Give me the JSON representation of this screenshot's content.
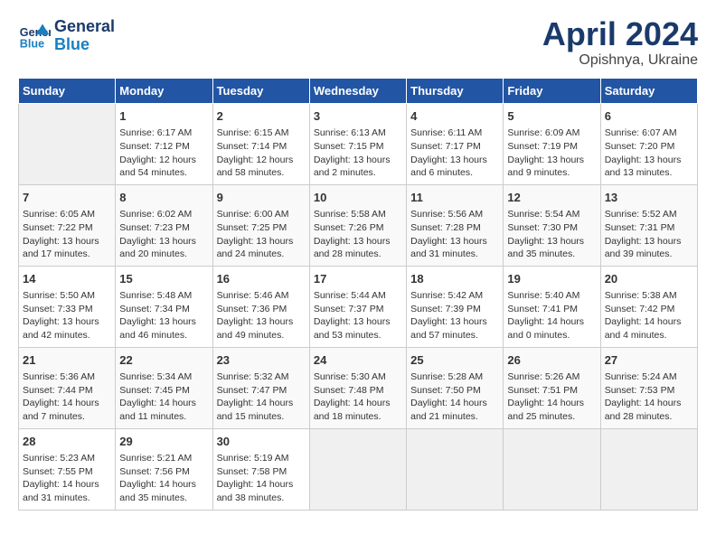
{
  "header": {
    "logo_line1": "General",
    "logo_line2": "Blue",
    "month": "April 2024",
    "location": "Opishnya, Ukraine"
  },
  "days_of_week": [
    "Sunday",
    "Monday",
    "Tuesday",
    "Wednesday",
    "Thursday",
    "Friday",
    "Saturday"
  ],
  "weeks": [
    [
      {
        "day": "",
        "content": ""
      },
      {
        "day": "1",
        "content": "Sunrise: 6:17 AM\nSunset: 7:12 PM\nDaylight: 12 hours\nand 54 minutes."
      },
      {
        "day": "2",
        "content": "Sunrise: 6:15 AM\nSunset: 7:14 PM\nDaylight: 12 hours\nand 58 minutes."
      },
      {
        "day": "3",
        "content": "Sunrise: 6:13 AM\nSunset: 7:15 PM\nDaylight: 13 hours\nand 2 minutes."
      },
      {
        "day": "4",
        "content": "Sunrise: 6:11 AM\nSunset: 7:17 PM\nDaylight: 13 hours\nand 6 minutes."
      },
      {
        "day": "5",
        "content": "Sunrise: 6:09 AM\nSunset: 7:19 PM\nDaylight: 13 hours\nand 9 minutes."
      },
      {
        "day": "6",
        "content": "Sunrise: 6:07 AM\nSunset: 7:20 PM\nDaylight: 13 hours\nand 13 minutes."
      }
    ],
    [
      {
        "day": "7",
        "content": "Sunrise: 6:05 AM\nSunset: 7:22 PM\nDaylight: 13 hours\nand 17 minutes."
      },
      {
        "day": "8",
        "content": "Sunrise: 6:02 AM\nSunset: 7:23 PM\nDaylight: 13 hours\nand 20 minutes."
      },
      {
        "day": "9",
        "content": "Sunrise: 6:00 AM\nSunset: 7:25 PM\nDaylight: 13 hours\nand 24 minutes."
      },
      {
        "day": "10",
        "content": "Sunrise: 5:58 AM\nSunset: 7:26 PM\nDaylight: 13 hours\nand 28 minutes."
      },
      {
        "day": "11",
        "content": "Sunrise: 5:56 AM\nSunset: 7:28 PM\nDaylight: 13 hours\nand 31 minutes."
      },
      {
        "day": "12",
        "content": "Sunrise: 5:54 AM\nSunset: 7:30 PM\nDaylight: 13 hours\nand 35 minutes."
      },
      {
        "day": "13",
        "content": "Sunrise: 5:52 AM\nSunset: 7:31 PM\nDaylight: 13 hours\nand 39 minutes."
      }
    ],
    [
      {
        "day": "14",
        "content": "Sunrise: 5:50 AM\nSunset: 7:33 PM\nDaylight: 13 hours\nand 42 minutes."
      },
      {
        "day": "15",
        "content": "Sunrise: 5:48 AM\nSunset: 7:34 PM\nDaylight: 13 hours\nand 46 minutes."
      },
      {
        "day": "16",
        "content": "Sunrise: 5:46 AM\nSunset: 7:36 PM\nDaylight: 13 hours\nand 49 minutes."
      },
      {
        "day": "17",
        "content": "Sunrise: 5:44 AM\nSunset: 7:37 PM\nDaylight: 13 hours\nand 53 minutes."
      },
      {
        "day": "18",
        "content": "Sunrise: 5:42 AM\nSunset: 7:39 PM\nDaylight: 13 hours\nand 57 minutes."
      },
      {
        "day": "19",
        "content": "Sunrise: 5:40 AM\nSunset: 7:41 PM\nDaylight: 14 hours\nand 0 minutes."
      },
      {
        "day": "20",
        "content": "Sunrise: 5:38 AM\nSunset: 7:42 PM\nDaylight: 14 hours\nand 4 minutes."
      }
    ],
    [
      {
        "day": "21",
        "content": "Sunrise: 5:36 AM\nSunset: 7:44 PM\nDaylight: 14 hours\nand 7 minutes."
      },
      {
        "day": "22",
        "content": "Sunrise: 5:34 AM\nSunset: 7:45 PM\nDaylight: 14 hours\nand 11 minutes."
      },
      {
        "day": "23",
        "content": "Sunrise: 5:32 AM\nSunset: 7:47 PM\nDaylight: 14 hours\nand 15 minutes."
      },
      {
        "day": "24",
        "content": "Sunrise: 5:30 AM\nSunset: 7:48 PM\nDaylight: 14 hours\nand 18 minutes."
      },
      {
        "day": "25",
        "content": "Sunrise: 5:28 AM\nSunset: 7:50 PM\nDaylight: 14 hours\nand 21 minutes."
      },
      {
        "day": "26",
        "content": "Sunrise: 5:26 AM\nSunset: 7:51 PM\nDaylight: 14 hours\nand 25 minutes."
      },
      {
        "day": "27",
        "content": "Sunrise: 5:24 AM\nSunset: 7:53 PM\nDaylight: 14 hours\nand 28 minutes."
      }
    ],
    [
      {
        "day": "28",
        "content": "Sunrise: 5:23 AM\nSunset: 7:55 PM\nDaylight: 14 hours\nand 31 minutes."
      },
      {
        "day": "29",
        "content": "Sunrise: 5:21 AM\nSunset: 7:56 PM\nDaylight: 14 hours\nand 35 minutes."
      },
      {
        "day": "30",
        "content": "Sunrise: 5:19 AM\nSunset: 7:58 PM\nDaylight: 14 hours\nand 38 minutes."
      },
      {
        "day": "",
        "content": ""
      },
      {
        "day": "",
        "content": ""
      },
      {
        "day": "",
        "content": ""
      },
      {
        "day": "",
        "content": ""
      }
    ]
  ]
}
